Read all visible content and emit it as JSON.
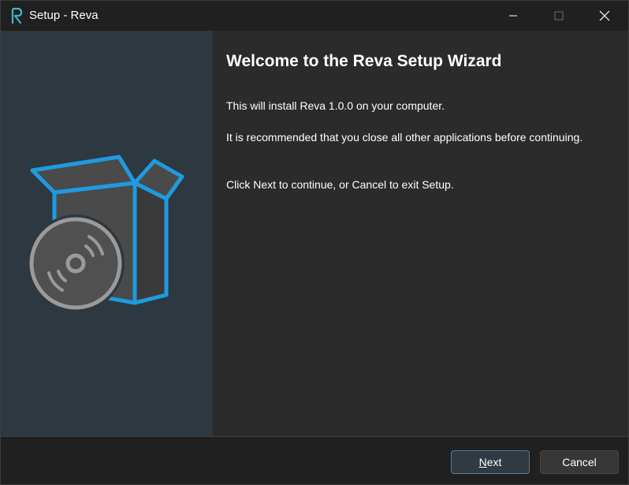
{
  "window": {
    "title": "Setup - Reva",
    "app_icon": "reva-logo-icon",
    "controls": [
      "minimize-icon",
      "maximize-icon",
      "close-icon"
    ]
  },
  "side_panel": {
    "graphic": "install-box-disc-icon"
  },
  "content": {
    "heading": "Welcome to the Reva Setup Wizard",
    "paragraphs": [
      "This will install Reva 1.0.0 on your computer.",
      "It is recommended that you close all other applications before continuing.",
      "Click Next to continue, or Cancel to exit Setup."
    ]
  },
  "footer": {
    "next_label": "Next",
    "cancel_label": "Cancel"
  },
  "colors": {
    "accent": "#1e9be0",
    "titlebar": "#202020",
    "side_panel": "#2e3840",
    "content_bg": "#2b2b2b"
  }
}
